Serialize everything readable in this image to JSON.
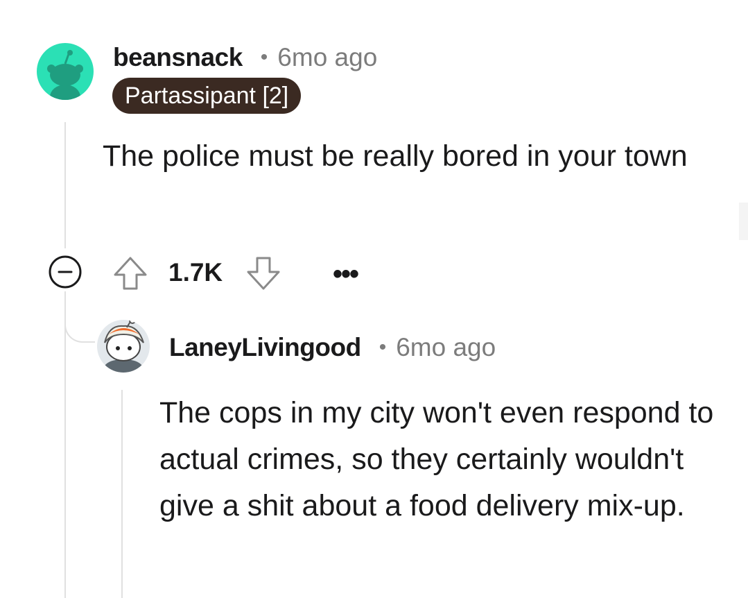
{
  "comment": {
    "username": "beansnack",
    "separator": "•",
    "time": "6mo ago",
    "flair": "Partassipant [2]",
    "body": "The police must be really bored in your town",
    "avatar_icon": "snoo-avatar-icon",
    "actions": {
      "collapse_icon": "minus-circle-icon",
      "upvote_icon": "arrow-up-icon",
      "score": "1.7K",
      "downvote_icon": "arrow-down-icon",
      "more_label": "•••"
    }
  },
  "reply": {
    "username": "LaneyLivingood",
    "separator": "•",
    "time": "6mo ago",
    "avatar_icon": "snoo-avatar-icon",
    "body": "The cops in my city won't even respond to actual crimes, so they certainly wouldn't give a shit about a food delivery mix-up."
  },
  "colors": {
    "avatar1_bg": "#2be0b5",
    "flair_bg": "#3b2a22",
    "meta_gray": "#7c7c7c",
    "thread_line": "#e0e0e0"
  }
}
